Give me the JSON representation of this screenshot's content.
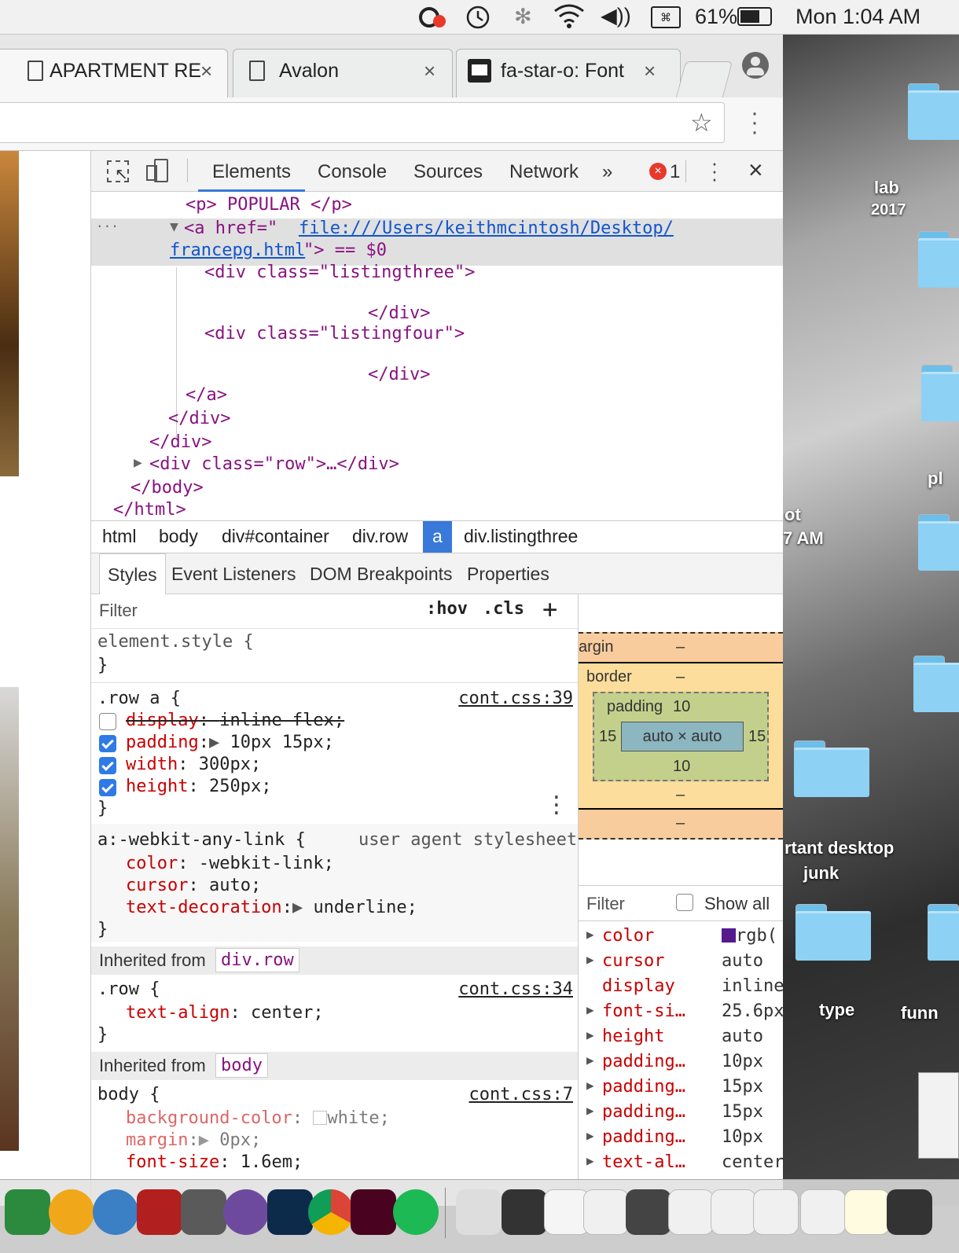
{
  "menubar": {
    "battery": "61%",
    "clock": "Mon 1:04 AM"
  },
  "tabs": [
    {
      "title": "APARTMENT RE",
      "close": "×"
    },
    {
      "title": "Avalon",
      "close": "×"
    },
    {
      "title": "fa-star-o: Font",
      "close": "×"
    }
  ],
  "devtools": {
    "tabs": [
      "Elements",
      "Console",
      "Sources",
      "Network",
      "»"
    ],
    "error_count": "1",
    "close": "×",
    "elements": {
      "l1": "<p> POPULAR </p>",
      "l2_tag": "<a href=\"",
      "l2_link": "file:///Users/keithmcintosh/Desktop/",
      "l3_link": "francepg.html",
      "l3_rest": "\"> == $0",
      "l4": "<div class=\"listingthree\">",
      "l5": "</div>",
      "l6": "<div class=\"listingfour\">",
      "l7": "</div>",
      "l8": "</a>",
      "l9": "</div>",
      "l10": "</div>",
      "l11": "<div class=\"row\">…</div>",
      "l12": "</body>",
      "l13": "</html>",
      "dots": "..."
    },
    "breadcrumbs": [
      "html",
      "body",
      "div#container",
      "div.row",
      "a",
      "div.listingthree"
    ],
    "subtabs": [
      "Styles",
      "Event Listeners",
      "DOM Breakpoints",
      "Properties"
    ],
    "styles": {
      "filter_placeholder": "Filter",
      "hov": ":hov",
      "cls": ".cls",
      "plus": "+",
      "element_style": "element.style {",
      "close_brace": "}",
      "rule1_selector": ".row a {",
      "rule1_source": "cont.css:39",
      "rule1_props": [
        {
          "name": "display",
          "value": "inline-flex;",
          "checked": false
        },
        {
          "name": "padding",
          "value": "10px 15px;",
          "checked": true
        },
        {
          "name": "width",
          "value": "300px;",
          "checked": true
        },
        {
          "name": "height",
          "value": "250px;",
          "checked": true
        }
      ],
      "ua_selector": "a:-webkit-any-link {",
      "ua_source": "user agent stylesheet",
      "ua_props": [
        {
          "name": "color",
          "value": "-webkit-link;"
        },
        {
          "name": "cursor",
          "value": "auto;"
        },
        {
          "name": "text-decoration",
          "value": "underline;"
        }
      ],
      "inherited_row_label": "Inherited from",
      "inherited_row_target": "div.row",
      "row_selector": ".row {",
      "row_source": "cont.css:34",
      "row_prop_name": "text-align",
      "row_prop_value": "center;",
      "inherited_body_label": "Inherited from",
      "inherited_body_target": "body",
      "body_selector": "body {",
      "body_source": "cont.css:7",
      "body_props": [
        {
          "name": "background-color",
          "value": "white;"
        },
        {
          "name": "margin",
          "value": "0px;"
        },
        {
          "name": "font-size",
          "value": "1.6em;"
        }
      ]
    },
    "boxmodel": {
      "margin_label": "argin",
      "margin_val": "–",
      "border_label": "border",
      "border_val": "–",
      "padding_label": "padding",
      "padding_top": "10",
      "padding_left": "15",
      "padding_right": "15",
      "padding_bottom": "10",
      "content": "auto × auto",
      "border_bottom": "–",
      "margin_bottom": "–"
    },
    "computed": {
      "filter_placeholder": "Filter",
      "show_all": "Show all",
      "rows": [
        {
          "name": "color",
          "value": "rgb(",
          "arrow": true
        },
        {
          "name": "cursor",
          "value": "auto",
          "arrow": true
        },
        {
          "name": "display",
          "value": "inline",
          "arrow": false
        },
        {
          "name": "font-si…",
          "value": "25.6px",
          "arrow": true
        },
        {
          "name": "height",
          "value": "auto",
          "arrow": true
        },
        {
          "name": "padding…",
          "value": "10px",
          "arrow": true
        },
        {
          "name": "padding…",
          "value": "15px",
          "arrow": true
        },
        {
          "name": "padding…",
          "value": "15px",
          "arrow": true
        },
        {
          "name": "padding…",
          "value": "10px",
          "arrow": true
        },
        {
          "name": "text-al…",
          "value": "center",
          "arrow": true
        }
      ]
    }
  },
  "desktop": {
    "labels": [
      "lab",
      "2017",
      "pl",
      "ot",
      "7 AM",
      "rtant desktop",
      "junk",
      "type",
      "funn"
    ]
  },
  "colors": {
    "accent": "#2f7ae5",
    "tag": "#881280",
    "attr": "#994500",
    "prop": "#c80000"
  }
}
